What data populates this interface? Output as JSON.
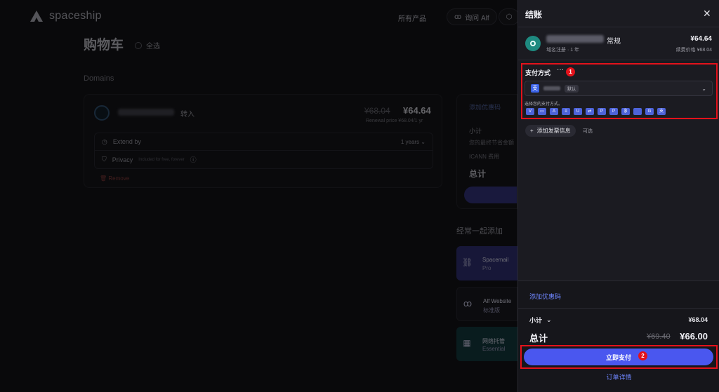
{
  "app": {
    "logo_text": "spaceship"
  },
  "nav": {
    "all_products": "所有产品",
    "ask_alf": "询问 Alf"
  },
  "cart": {
    "title": "购物车",
    "select_all": "全选",
    "domains_label": "Domains",
    "domain": {
      "transfer_label": "转入",
      "old_price": "¥68.04",
      "new_price": "¥64.64",
      "renewal": "Renewal price ¥68.04/1 yr",
      "extend_label": "Extend by",
      "extend_value": "1 years",
      "privacy_label": "Privacy",
      "privacy_note": "Included for free, forever",
      "remove_label": "Remove"
    }
  },
  "summary": {
    "coupon": "添加优惠码",
    "subtotal": "小计",
    "savings": "您的最终节省金额",
    "icann": "ICANN 费用",
    "total": "总计"
  },
  "often_added": {
    "label": "经常一起添加",
    "items": [
      {
        "title": "Spacemail",
        "subtitle": "Pro"
      },
      {
        "title": "Alf Website",
        "subtitle": "标准版"
      },
      {
        "title": "网络托管",
        "subtitle": "Essential"
      }
    ]
  },
  "checkout": {
    "title": "结账",
    "item": {
      "type": "常规",
      "price": "¥64.64",
      "sub": "域名注册 · 1 年",
      "renewal": "续费价格 ¥68.04"
    },
    "payment": {
      "title": "支付方式",
      "more": "···",
      "marker1": "1",
      "default_badge": "默认",
      "choose_label": "选择您的支付方式。",
      "methods": [
        "visa",
        "card",
        "amex",
        "bank",
        "cup",
        "wire",
        "pay",
        "pp",
        "btc",
        "apple",
        "g",
        "alipay"
      ]
    },
    "invoice": {
      "button": "添加发票信息",
      "optional": "可选"
    },
    "footer": {
      "coupon": "添加优惠码",
      "subtotal_label": "小计",
      "subtotal_value": "¥68.04",
      "total_label": "总计",
      "total_old": "¥69.40",
      "total_new": "¥66.00",
      "pay_now": "立即支付",
      "marker2": "2",
      "order_details": "订单详情"
    }
  },
  "colors": {
    "accent": "#4a57ef",
    "highlight": "#e3121b",
    "link": "#6f86ff"
  }
}
